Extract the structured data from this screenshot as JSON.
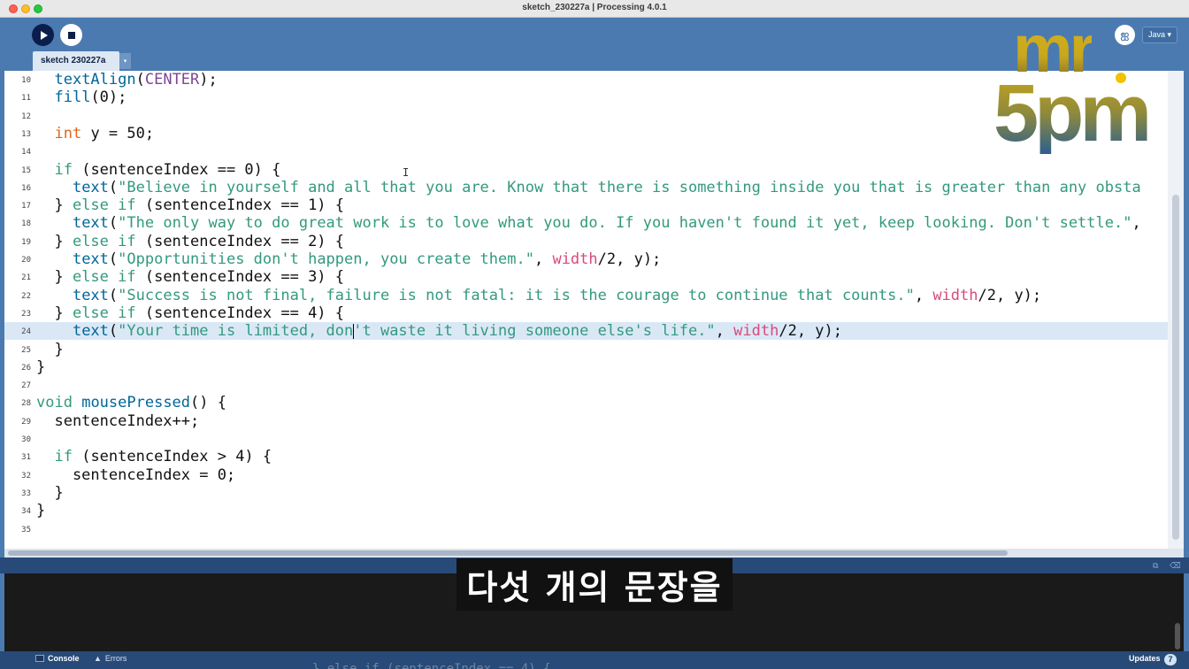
{
  "window": {
    "title": "sketch_230227a | Processing 4.0.1"
  },
  "toolbar": {
    "run_icon": "play-icon",
    "stop_icon": "stop-icon",
    "debug_icon": "butterfly-icon",
    "debug_glyph": "ஐ",
    "mode_label": "Java ▾"
  },
  "tabs": {
    "active_label": "sketch 230227a",
    "menu_glyph": "▾"
  },
  "editor": {
    "ibeam_glyph": "I",
    "lines": [
      {
        "n": "10",
        "html": "  <span class=\"fn\">textAlign</span>(<span class=\"str\">CENTER</span>);"
      },
      {
        "n": "11",
        "html": "  <span class=\"fn\">fill</span>(0);"
      },
      {
        "n": "12",
        "html": ""
      },
      {
        "n": "13",
        "html": "  <span class=\"kw\">int</span> y = 50;"
      },
      {
        "n": "14",
        "html": ""
      },
      {
        "n": "15",
        "html": "  <span class=\"kw2\">if</span> (sentenceIndex == 0) {"
      },
      {
        "n": "16",
        "html": "    <span class=\"fn\">text</span>(<span class=\"kw2\">\"Believe in yourself and all that you are. Know that there is something inside you that is greater than any obsta</span>"
      },
      {
        "n": "17",
        "html": "  } <span class=\"kw2\">else if</span> (sentenceIndex == 1) {"
      },
      {
        "n": "18",
        "html": "    <span class=\"fn\">text</span>(<span class=\"kw2\">\"The only way to do great work is to love what you do. If you haven't found it yet, keep looking. Don't settle.\"</span>,"
      },
      {
        "n": "19",
        "html": "  } <span class=\"kw2\">else if</span> (sentenceIndex == 2) {"
      },
      {
        "n": "20",
        "html": "    <span class=\"fn\">text</span>(<span class=\"kw2\">\"Opportunities don't happen, you create them.\"</span>, <span class=\"var\">width</span>/2, y);"
      },
      {
        "n": "21",
        "html": "  } <span class=\"kw2\">else if</span> (sentenceIndex == 3) {"
      },
      {
        "n": "22",
        "html": "    <span class=\"fn\">text</span>(<span class=\"kw2\">\"Success is not final, failure is not fatal: it is the courage to continue that counts.\"</span>, <span class=\"var\">width</span>/2, y);"
      },
      {
        "n": "23",
        "html": "  } <span class=\"kw2\">else if</span> (sentenceIndex == 4) {"
      },
      {
        "n": "24",
        "html": "    <span class=\"fn\">text</span>(<span class=\"kw2\">\"Your time is limited, don't waste it living someone else's life.\"</span>, <span class=\"var\">width</span>/2, y);",
        "current": true
      },
      {
        "n": "25",
        "html": "  }"
      },
      {
        "n": "26",
        "html": "}"
      },
      {
        "n": "27",
        "html": ""
      },
      {
        "n": "28",
        "html": "<span class=\"kw2\">void</span> <span class=\"fn\">mousePressed</span>() {"
      },
      {
        "n": "29",
        "html": "  sentenceIndex++;"
      },
      {
        "n": "30",
        "html": ""
      },
      {
        "n": "31",
        "html": "  <span class=\"kw2\">if</span> (sentenceIndex > 4) {"
      },
      {
        "n": "32",
        "html": "    sentenceIndex = 0;"
      },
      {
        "n": "33",
        "html": "  }"
      },
      {
        "n": "34",
        "html": "}"
      },
      {
        "n": "35",
        "html": ""
      }
    ]
  },
  "logo": {
    "line1": "mr",
    "line2": "5pm"
  },
  "subtitle": "다섯 개의 문장을",
  "footer": {
    "console_label": "Console",
    "errors_label": "Errors",
    "errors_glyph": "▲",
    "updates_label": "Updates",
    "updates_count": "7",
    "ghost_code": "  } else if (sentenceIndex == 4) {"
  },
  "colors": {
    "keyword_green": "#33997e",
    "function_blue": "#006699",
    "type_orange": "#e2661a",
    "builtin_var_pink": "#d94a7a",
    "ui_blue": "#4a7ab0"
  }
}
